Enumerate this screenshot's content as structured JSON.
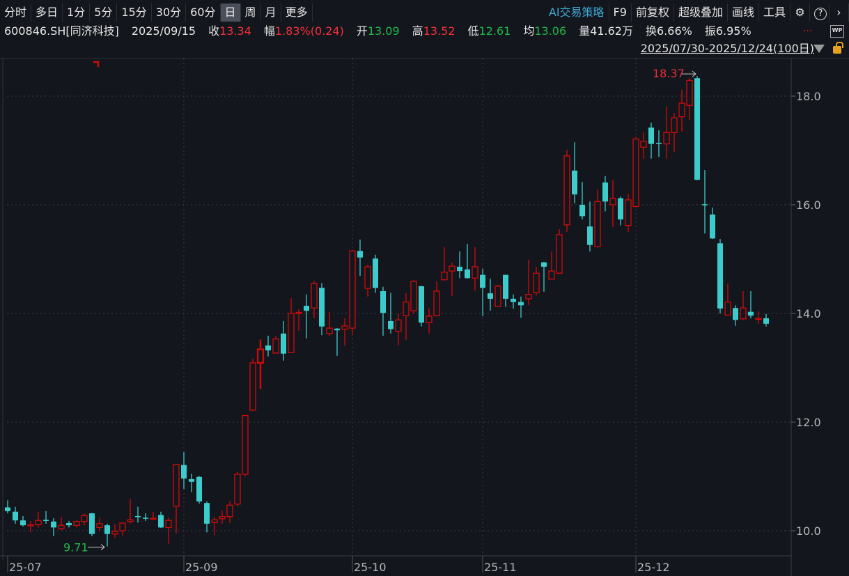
{
  "toolbar": {
    "periods": [
      "分时",
      "多日",
      "1分",
      "5分",
      "15分",
      "30分",
      "60分",
      "日",
      "周",
      "月",
      "更多"
    ],
    "active_period": "日",
    "right": [
      "AI交易策略",
      "F9",
      "前复权",
      "超级叠加",
      "画线",
      "工具"
    ],
    "icons": [
      "gear-icon",
      "help-icon",
      "chevron-right-icon"
    ]
  },
  "info": {
    "symbol": "600846.SH[同济科技]",
    "date": "2025/09/15",
    "close_label": "收",
    "close": "13.34",
    "change_label": "幅",
    "change": "1.83%(0.24)",
    "open_label": "开",
    "open": "13.09",
    "high_label": "高",
    "high": "13.52",
    "low_label": "低",
    "low": "12.61",
    "avg_label": "均",
    "avg": "13.06",
    "volume_label": "量",
    "volume": "41.62万",
    "turnover_label": "换",
    "turnover": "6.66%",
    "amplitude_label": "振",
    "amplitude": "6.95%",
    "more": "...",
    "wp": "WP"
  },
  "range": "2025/07/30-2025/12/24(100日)",
  "colors": {
    "up": "#d40a0a",
    "down": "#3ccccc",
    "bg": "#13161c",
    "grid": "#3a3e48"
  },
  "chart_data": {
    "type": "candlestick",
    "ohlc_order": [
      "open",
      "high",
      "low",
      "close"
    ],
    "candles": [
      [
        10.43,
        10.56,
        10.32,
        10.36
      ],
      [
        10.35,
        10.44,
        10.13,
        10.19
      ],
      [
        10.19,
        10.27,
        10.08,
        10.1
      ],
      [
        10.09,
        10.18,
        9.97,
        10.11
      ],
      [
        10.11,
        10.35,
        10.06,
        10.19
      ],
      [
        10.2,
        10.36,
        10.13,
        10.18
      ],
      [
        10.17,
        10.23,
        9.9,
        10.06
      ],
      [
        10.04,
        10.25,
        10.01,
        10.1
      ],
      [
        10.14,
        10.18,
        10.06,
        10.1
      ],
      [
        10.1,
        10.19,
        10.06,
        10.17
      ],
      [
        10.17,
        10.32,
        10.1,
        10.28
      ],
      [
        10.32,
        10.33,
        9.9,
        9.94
      ],
      [
        10.06,
        10.24,
        9.99,
        10.13
      ],
      [
        10.1,
        10.13,
        9.71,
        9.94
      ],
      [
        9.94,
        10.12,
        9.87,
        9.99
      ],
      [
        10.0,
        10.14,
        9.91,
        10.14
      ],
      [
        10.17,
        10.59,
        10.13,
        10.2
      ],
      [
        10.27,
        10.44,
        10.15,
        10.25
      ],
      [
        10.24,
        10.32,
        10.18,
        10.22
      ],
      [
        10.22,
        10.35,
        10.21,
        10.23
      ],
      [
        10.29,
        10.35,
        10.05,
        10.06
      ],
      [
        10.06,
        10.24,
        9.76,
        10.19
      ],
      [
        10.45,
        11.23,
        9.95,
        11.22
      ],
      [
        11.21,
        11.45,
        10.77,
        10.96
      ],
      [
        10.95,
        11.05,
        10.71,
        10.9
      ],
      [
        10.99,
        11.01,
        10.5,
        10.54
      ],
      [
        10.51,
        10.54,
        9.97,
        10.13
      ],
      [
        10.15,
        10.25,
        9.92,
        10.2
      ],
      [
        10.22,
        10.38,
        10.13,
        10.26
      ],
      [
        10.26,
        10.54,
        10.14,
        10.47
      ],
      [
        10.49,
        11.09,
        10.45,
        11.04
      ],
      [
        11.04,
        12.13,
        11.0,
        12.12
      ],
      [
        12.22,
        13.17,
        12.2,
        13.09
      ],
      [
        13.09,
        13.52,
        12.61,
        13.34
      ],
      [
        13.41,
        13.59,
        13.21,
        13.32
      ],
      [
        13.27,
        13.59,
        13.26,
        13.53
      ],
      [
        13.63,
        13.86,
        13.13,
        13.26
      ],
      [
        13.28,
        14.28,
        13.27,
        14.0
      ],
      [
        14.0,
        14.08,
        13.68,
        14.02
      ],
      [
        14.14,
        14.35,
        13.54,
        14.05
      ],
      [
        14.1,
        14.6,
        13.91,
        14.55
      ],
      [
        14.47,
        14.56,
        13.6,
        13.76
      ],
      [
        13.63,
        14.03,
        13.59,
        13.73
      ],
      [
        13.72,
        13.73,
        13.22,
        13.69
      ],
      [
        13.71,
        13.91,
        13.41,
        13.77
      ],
      [
        13.73,
        15.17,
        13.6,
        15.15
      ],
      [
        15.15,
        15.36,
        14.69,
        15.03
      ],
      [
        14.46,
        14.9,
        14.31,
        14.86
      ],
      [
        15.01,
        15.08,
        14.38,
        14.47
      ],
      [
        14.41,
        14.49,
        13.59,
        14.01
      ],
      [
        13.86,
        14.38,
        13.63,
        13.71
      ],
      [
        13.67,
        14.0,
        13.41,
        13.88
      ],
      [
        13.96,
        14.37,
        13.51,
        14.21
      ],
      [
        14.05,
        14.62,
        13.99,
        14.59
      ],
      [
        14.5,
        14.51,
        13.76,
        13.83
      ],
      [
        13.83,
        14.09,
        13.63,
        13.95
      ],
      [
        13.96,
        14.59,
        13.95,
        14.41
      ],
      [
        14.62,
        15.22,
        14.6,
        14.76
      ],
      [
        14.78,
        14.94,
        14.32,
        14.87
      ],
      [
        14.86,
        15.14,
        14.65,
        14.78
      ],
      [
        14.81,
        15.28,
        14.64,
        14.65
      ],
      [
        14.65,
        15.22,
        14.42,
        14.86
      ],
      [
        14.71,
        14.82,
        13.95,
        14.47
      ],
      [
        14.37,
        14.64,
        14.05,
        14.27
      ],
      [
        14.13,
        14.53,
        14.12,
        14.5
      ],
      [
        14.71,
        14.71,
        14.12,
        14.27
      ],
      [
        14.27,
        14.35,
        14.09,
        14.21
      ],
      [
        14.21,
        14.31,
        13.92,
        14.15
      ],
      [
        14.27,
        14.99,
        14.15,
        14.35
      ],
      [
        14.38,
        14.86,
        14.33,
        14.74
      ],
      [
        14.94,
        14.95,
        14.4,
        14.86
      ],
      [
        14.63,
        15.14,
        14.62,
        14.78
      ],
      [
        14.74,
        15.55,
        14.73,
        15.45
      ],
      [
        15.63,
        17.01,
        15.5,
        16.9
      ],
      [
        16.63,
        17.15,
        16.03,
        16.19
      ],
      [
        16.0,
        16.42,
        15.73,
        15.79
      ],
      [
        15.6,
        16.06,
        15.14,
        15.26
      ],
      [
        15.23,
        16.28,
        15.22,
        16.06
      ],
      [
        16.41,
        16.53,
        15.88,
        16.06
      ],
      [
        16.0,
        16.45,
        15.59,
        16.12
      ],
      [
        16.12,
        16.15,
        15.62,
        15.73
      ],
      [
        15.62,
        16.21,
        15.5,
        16.09
      ],
      [
        15.97,
        17.25,
        15.95,
        17.21
      ],
      [
        17.06,
        17.33,
        16.85,
        17.17
      ],
      [
        17.42,
        17.51,
        16.85,
        17.12
      ],
      [
        17.14,
        17.37,
        16.88,
        17.12
      ],
      [
        17.12,
        17.81,
        16.85,
        17.33
      ],
      [
        17.33,
        17.69,
        16.97,
        17.6
      ],
      [
        17.62,
        18.12,
        17.35,
        17.87
      ],
      [
        17.83,
        18.33,
        17.56,
        18.29
      ],
      [
        18.33,
        18.37,
        16.45,
        16.46
      ],
      [
        16.01,
        16.64,
        15.47,
        15.99
      ],
      [
        15.82,
        15.95,
        15.37,
        15.38
      ],
      [
        15.29,
        15.37,
        14.0,
        14.09
      ],
      [
        13.97,
        14.55,
        13.96,
        14.21
      ],
      [
        14.1,
        14.15,
        13.77,
        13.88
      ],
      [
        13.9,
        14.41,
        13.88,
        14.1
      ],
      [
        14.03,
        14.41,
        13.91,
        13.96
      ],
      [
        13.9,
        14.04,
        13.81,
        13.91
      ],
      [
        13.91,
        13.99,
        13.76,
        13.81
      ]
    ],
    "selected_index": 33,
    "y_ticks": [
      "10.0",
      "12.0",
      "14.0",
      "16.0",
      "18.0"
    ],
    "ylim": [
      9.6,
      18.6
    ],
    "x_ticks": [
      {
        "label": "25-07",
        "index": 0
      },
      {
        "label": "25-09",
        "index": 23
      },
      {
        "label": "25-10",
        "index": 45
      },
      {
        "label": "25-11",
        "index": 62
      },
      {
        "label": "25-12",
        "index": 82
      }
    ],
    "annotations": [
      {
        "text": "18.37",
        "index": 90,
        "value": 18.37,
        "color": "#e8303a"
      },
      {
        "text": "9.71",
        "index": 13,
        "value": 9.71,
        "color": "#20b848"
      }
    ],
    "grid": true
  }
}
